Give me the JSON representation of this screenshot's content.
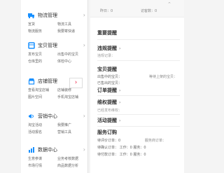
{
  "sidebar": {
    "sections": [
      {
        "title": "物流管理",
        "icon": "truck-icon",
        "links": [
          [
            "宣货",
            "物流工具"
          ],
          [
            "物流服务",
            "我要寄快递"
          ]
        ]
      },
      {
        "title": "宝贝管理",
        "icon": "box-icon",
        "links": [
          [
            "发布宝贝",
            "出售中的宝贝"
          ],
          [
            "仓库里的",
            "体检中心"
          ]
        ]
      },
      {
        "title": "店铺管理",
        "icon": "shop-icon",
        "links": [
          [
            "查看淘宝店铺",
            "店铺装修"
          ],
          [
            "图片空间",
            "手机淘宝店铺"
          ]
        ]
      },
      {
        "title": "营销中心",
        "icon": "megaphone-icon",
        "links": [
          [
            "淘宝活动",
            "我要推广"
          ],
          [
            "活动报名",
            "营销工具"
          ]
        ]
      },
      {
        "title": "数据中心",
        "icon": "chart-icon",
        "links": [
          [
            "生意参谋",
            "业务考核数据"
          ],
          [
            "市场行情",
            "商品数据分析"
          ]
        ]
      }
    ],
    "expand_arrow": "›"
  },
  "content": {
    "header_left": "昨日：0",
    "header_right": "访客数：0",
    "heading_reminders": "重要提醒",
    "violations": {
      "title": "违规提醒",
      "sub": "违规记录："
    },
    "baby": {
      "title": "宝贝提醒",
      "row1": "出售中的宝贝：",
      "row1_right": "等待上架的宝贝：",
      "row2": "已售出的宝贝："
    },
    "orders": {
      "title": "订单提醒"
    },
    "rights": {
      "title": "维权提醒",
      "sub": "已经发布维权："
    },
    "activities": {
      "title": "活动提醒"
    },
    "service": {
      "title": "服务订购",
      "r1": "待评价订单：0",
      "r1b": "服务商订单：",
      "r2": "待确认订单：  工作：0  服务：0",
      "r3": "待付款订单：  工作：0  服务：0"
    }
  }
}
